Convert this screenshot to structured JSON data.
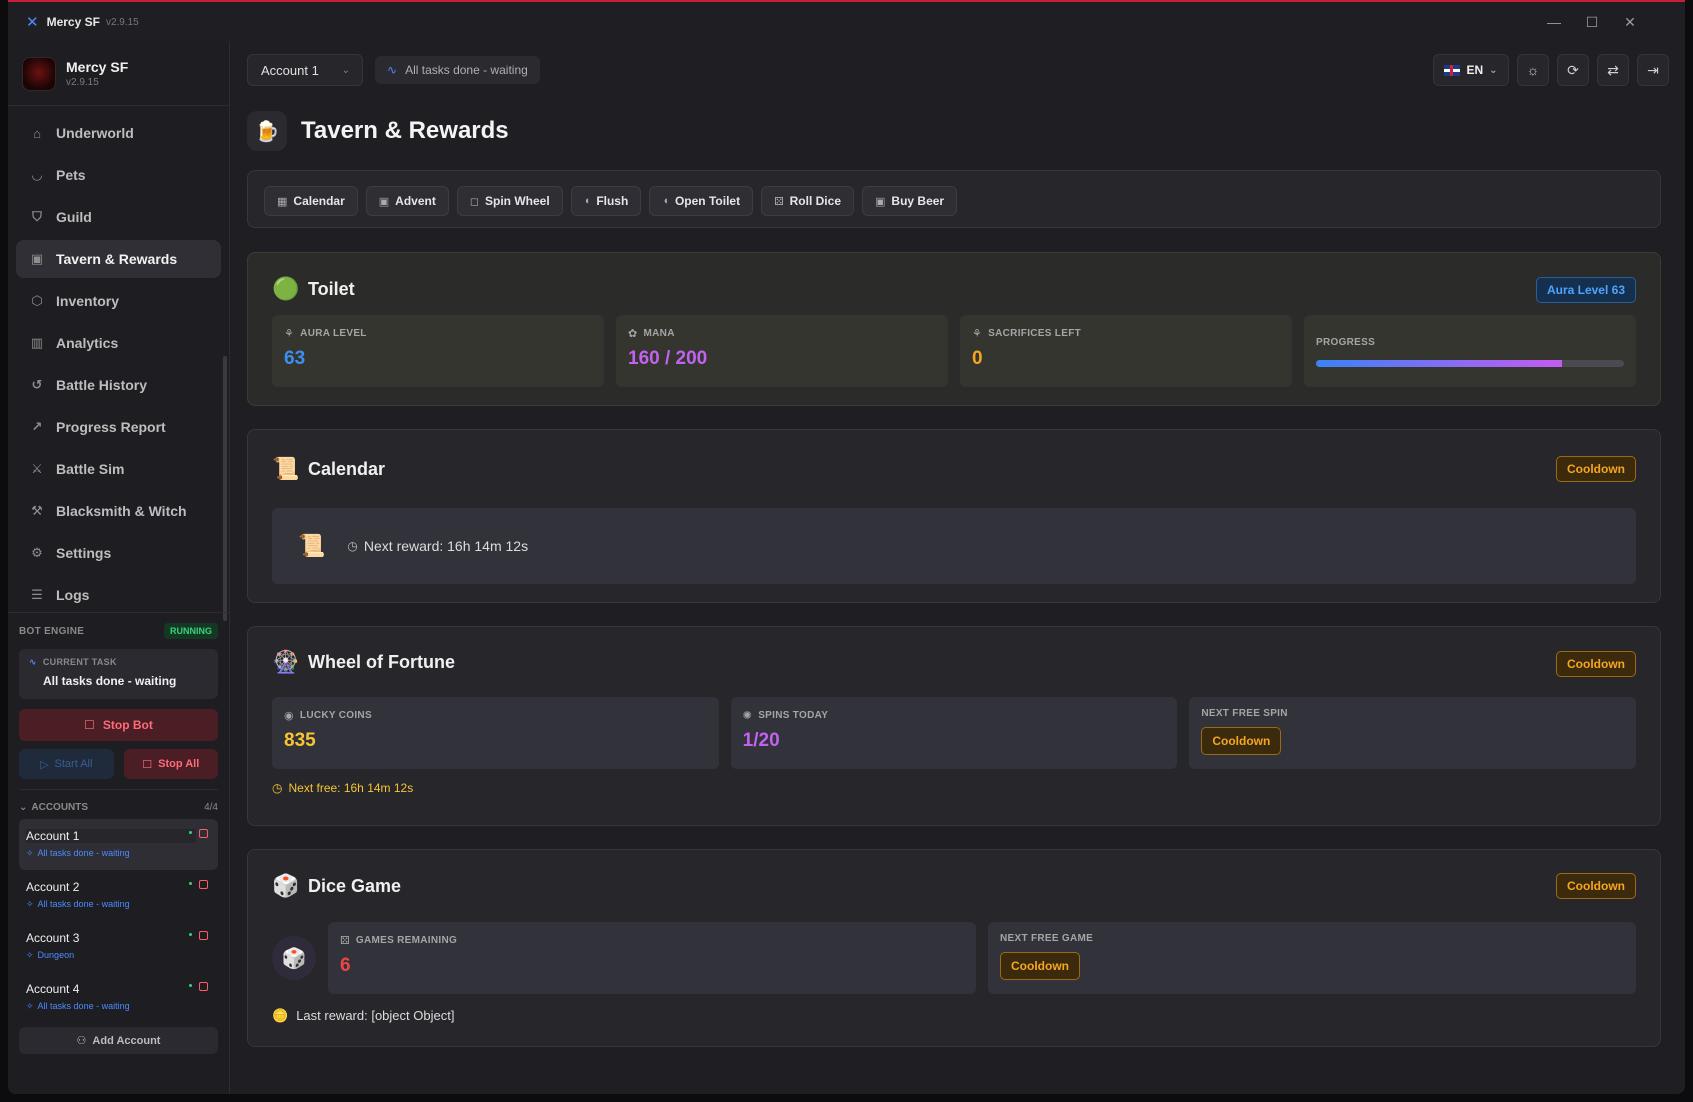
{
  "window": {
    "app_name": "Mercy SF",
    "version": "v2.9.15"
  },
  "sidebar": {
    "brand_name": "Mercy SF",
    "brand_version": "v2.9.15",
    "items": [
      {
        "label": "Underworld",
        "icon": "home-icon"
      },
      {
        "label": "Pets",
        "icon": "pet-icon"
      },
      {
        "label": "Guild",
        "icon": "shield-icon"
      },
      {
        "label": "Tavern & Rewards",
        "icon": "gift-icon"
      },
      {
        "label": "Inventory",
        "icon": "box-icon"
      },
      {
        "label": "Analytics",
        "icon": "bar-chart-icon"
      },
      {
        "label": "Battle History",
        "icon": "history-icon"
      },
      {
        "label": "Progress Report",
        "icon": "trend-icon"
      },
      {
        "label": "Battle Sim",
        "icon": "swords-icon"
      },
      {
        "label": "Blacksmith & Witch",
        "icon": "hammer-icon"
      },
      {
        "label": "Settings",
        "icon": "gear-icon"
      },
      {
        "label": "Logs",
        "icon": "logs-icon"
      }
    ],
    "active_item": "Tavern & Rewards",
    "engine": {
      "label": "BOT ENGINE",
      "status": "RUNNING",
      "current_task_label": "CURRENT TASK",
      "current_task": "All tasks done - waiting",
      "stop_bot": "Stop Bot",
      "start_all": "Start All",
      "stop_all": "Stop All"
    },
    "accounts": {
      "label": "ACCOUNTS",
      "count": "4/4",
      "list": [
        {
          "name": "Account 1",
          "status": "All tasks done - waiting"
        },
        {
          "name": "Account 2",
          "status": "All tasks done - waiting"
        },
        {
          "name": "Account 3",
          "status": "Dungeon"
        },
        {
          "name": "Account 4",
          "status": "All tasks done - waiting"
        }
      ],
      "add_label": "Add Account"
    }
  },
  "topbar": {
    "account_selected": "Account 1",
    "status": "All tasks done - waiting",
    "language": "EN"
  },
  "page": {
    "title": "Tavern & Rewards"
  },
  "actions": [
    "Calendar",
    "Advent",
    "Spin Wheel",
    "Flush",
    "Open Toilet",
    "Roll Dice",
    "Buy Beer"
  ],
  "toilet": {
    "title": "Toilet",
    "badge": "Aura Level 63",
    "aura_label": "AURA LEVEL",
    "aura_value": "63",
    "mana_label": "MANA",
    "mana_value": "160 / 200",
    "sacrifices_label": "SACRIFICES LEFT",
    "sacrifices_value": "0",
    "progress_label": "PROGRESS",
    "progress_fraction": 0.8,
    "colors": {
      "aura": "#3b8ff0",
      "mana": "#c163ef",
      "sacrifices": "#f5a623"
    }
  },
  "calendar": {
    "title": "Calendar",
    "badge": "Cooldown",
    "next_reward": "Next reward: 16h 14m 12s"
  },
  "wheel": {
    "title": "Wheel of Fortune",
    "badge": "Cooldown",
    "coins_label": "LUCKY COINS",
    "coins_value": "835",
    "spins_label": "SPINS TODAY",
    "spins_value": "1/20",
    "next_spin_label": "NEXT FREE SPIN",
    "next_spin_value": "Cooldown",
    "next_free": "Next free: 16h 14m 12s"
  },
  "dice": {
    "title": "Dice Game",
    "badge": "Cooldown",
    "games_label": "GAMES REMAINING",
    "games_value": "6",
    "next_game_label": "NEXT FREE GAME",
    "next_game_value": "Cooldown",
    "last_reward": "Last reward: [object Object]"
  }
}
